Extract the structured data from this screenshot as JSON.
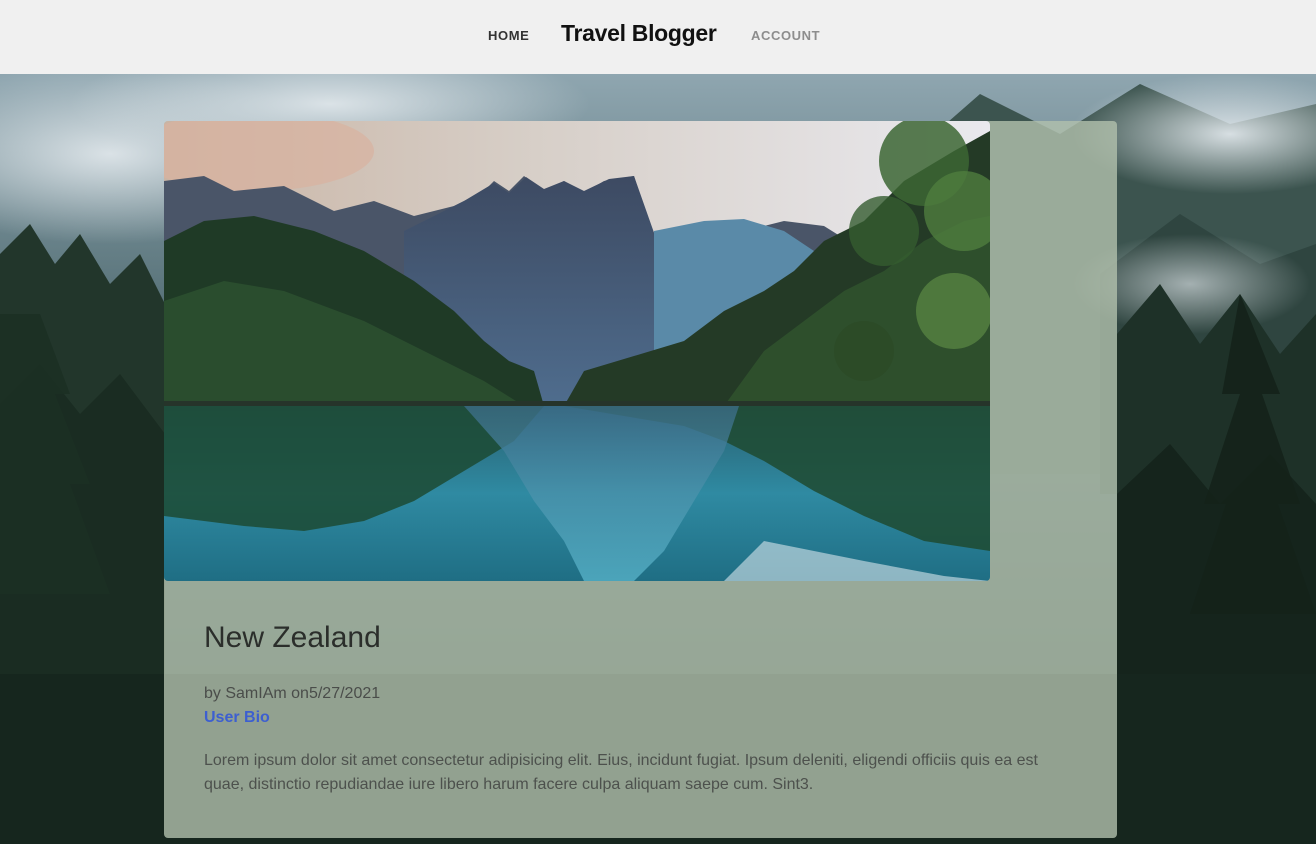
{
  "nav": {
    "home_label": "HOME",
    "brand": "Travel Blogger",
    "account_label": "ACCOUNT"
  },
  "post": {
    "title": "New Zealand",
    "byline_prefix": "by",
    "author": "SamIAm",
    "date_prefix": "on",
    "date": "5/27/2021",
    "bio_link": "User Bio",
    "body": "Lorem ipsum dolor sit amet consectetur adipisicing elit. Eius, incidunt fugiat. Ipsum deleniti, eligendi officiis quis ea est quae, distinctio repudiandae iure libero harum facere culpa aliquam saepe cum. Sint3."
  },
  "colors": {
    "nav_background": "#f0f0f0",
    "card_background": "#b2c0ac",
    "link_accent": "#3d5fd0"
  }
}
